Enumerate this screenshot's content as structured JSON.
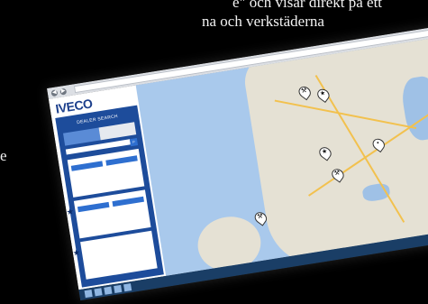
{
  "caption": {
    "line1": "e\" och visar direkt på ett",
    "line2": "na och verkstäderna",
    "line3": "e"
  },
  "browser": {
    "url": "",
    "nav_back": "◀",
    "nav_forward": "▶"
  },
  "page": {
    "brand": "IVECO",
    "panel_title": "DEALER SEARCH",
    "tabs": [
      "",
      ""
    ],
    "search": {
      "placeholder": "",
      "button_icon": "search-icon"
    }
  },
  "results": [
    {
      "name": "",
      "address": ""
    },
    {
      "name": "",
      "address": ""
    },
    {
      "name": "",
      "address": ""
    }
  ],
  "map": {
    "pins": [
      {
        "kind": "wrench"
      },
      {
        "kind": "star"
      },
      {
        "kind": "star"
      },
      {
        "kind": "location"
      },
      {
        "kind": "wrench"
      },
      {
        "kind": "wrench"
      }
    ]
  },
  "taskbar": {
    "icons": [
      "ie-icon",
      "folder-icon",
      "media-icon",
      "app-icon",
      "app-icon"
    ],
    "clock": ""
  },
  "colors": {
    "panel": "#1d4c9b",
    "accent": "#2e6fd0",
    "brand": "#1c3f8c"
  }
}
